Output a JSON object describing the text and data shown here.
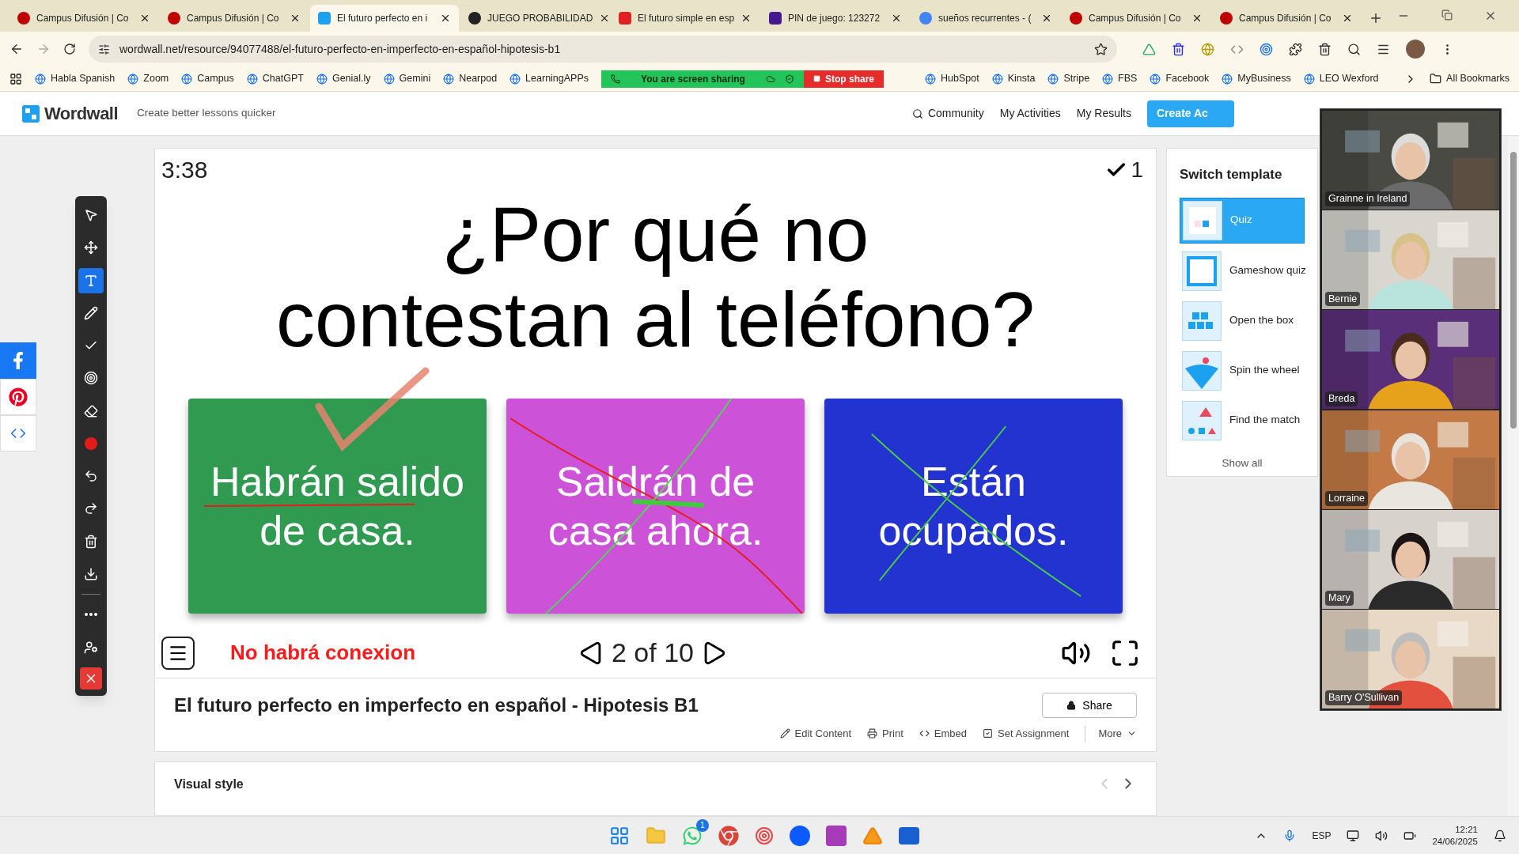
{
  "browser": {
    "tabs": [
      {
        "title": "Campus Difusión | Co",
        "kind": "campus",
        "selected": false
      },
      {
        "title": "Campus Difusión | Co",
        "kind": "campus",
        "selected": false
      },
      {
        "title": "El futuro perfecto en i",
        "kind": "wordwall",
        "selected": true
      },
      {
        "title": "JUEGO PROBABILIDAD",
        "kind": "genially",
        "selected": false
      },
      {
        "title": "El futuro simple en esp",
        "kind": "red",
        "selected": false
      },
      {
        "title": "PIN de juego: 123272",
        "kind": "kahoot",
        "selected": false
      },
      {
        "title": "sueños recurrentes - (",
        "kind": "google",
        "selected": false
      },
      {
        "title": "Campus Difusión | Co",
        "kind": "campus",
        "selected": false
      },
      {
        "title": "Campus Difusión | Co",
        "kind": "campus",
        "selected": false
      }
    ],
    "url": "wordwall.net/resource/94077488/el-futuro-perfecto-en-imperfecto-en-español-hipotesis-b1",
    "bookmarks_left": [
      "Habla Spanish",
      "Zoom",
      "Campus",
      "ChatGPT",
      "Genial.ly",
      "Gemini",
      "Nearpod",
      "LearningAPPs"
    ],
    "bookmarks_right": [
      "HubSpot",
      "Kinsta",
      "Stripe",
      "FBS",
      "Facebook",
      "MyBusiness",
      "LEO Wexford"
    ],
    "all_bookmarks": "All Bookmarks"
  },
  "screen_share": {
    "status": "You are screen sharing",
    "stop": "Stop share"
  },
  "header": {
    "logo": "Wordwall",
    "tagline": "Create better lessons quicker",
    "nav": [
      "Community",
      "My Activities",
      "My Results"
    ],
    "create": "Create Ac"
  },
  "tools": [
    {
      "kind": "pointer",
      "selected": false
    },
    {
      "kind": "move",
      "selected": false
    },
    {
      "kind": "text",
      "selected": true
    },
    {
      "kind": "pen",
      "selected": false
    },
    {
      "kind": "check",
      "selected": false
    },
    {
      "kind": "spotlight",
      "selected": false
    },
    {
      "kind": "eraser",
      "selected": false
    },
    {
      "kind": "record",
      "selected": false
    },
    {
      "kind": "undo",
      "selected": false
    },
    {
      "kind": "redo",
      "selected": false
    },
    {
      "kind": "trash",
      "selected": false
    },
    {
      "kind": "download",
      "selected": false
    },
    {
      "kind": "more",
      "selected": false
    },
    {
      "kind": "user",
      "selected": false
    },
    {
      "kind": "close",
      "selected": false
    }
  ],
  "game": {
    "timer": "3:38",
    "score": "1",
    "question": [
      "¿Por qué no",
      "contestan al teléfono?"
    ],
    "answers": [
      {
        "text": [
          "Habrán salido",
          "de casa."
        ],
        "color": "#2f9a50",
        "kind": "tick"
      },
      {
        "text": [
          "Saldrán de",
          "casa ahora."
        ],
        "color": "#cc52d8",
        "kind": "scribble"
      },
      {
        "text": [
          "Están",
          "ocupados."
        ],
        "color": "#2333cf",
        "kind": "cross"
      }
    ],
    "note": "No habrá conexion",
    "progress": "2 of 10"
  },
  "activity": {
    "title": "El futuro perfecto en imperfecto en español - Hipotesis B1",
    "share": "Share",
    "actions": [
      {
        "kind": "edit",
        "label": "Edit Content"
      },
      {
        "kind": "print",
        "label": "Print"
      },
      {
        "kind": "embed",
        "label": "Embed"
      },
      {
        "kind": "assign",
        "label": "Set Assignment"
      },
      {
        "kind": "more",
        "label": "More"
      }
    ]
  },
  "visual_style": {
    "title": "Visual style"
  },
  "templates": {
    "title": "Switch template",
    "items": [
      {
        "kind": "quiz",
        "label": "Quiz",
        "selected": true
      },
      {
        "kind": "gameshow",
        "label": "Gameshow quiz",
        "selected": false
      },
      {
        "kind": "box",
        "label": "Open the box",
        "selected": false
      },
      {
        "kind": "wheel",
        "label": "Spin the wheel",
        "selected": false
      },
      {
        "kind": "match",
        "label": "Find the match",
        "selected": false
      }
    ],
    "show_all": "Show all"
  },
  "participants": [
    {
      "name": "Grainne in Ireland",
      "kind": "picture"
    },
    {
      "name": "Bernie",
      "kind": "picture"
    },
    {
      "name": "Breda",
      "kind": "picture"
    },
    {
      "name": "Lorraine",
      "kind": "picture"
    },
    {
      "name": "Mary",
      "kind": "picture"
    },
    {
      "name": "Barry O'Sullivan",
      "kind": "picture"
    }
  ],
  "taskbar": {
    "badge": "1",
    "language": "ESP",
    "time": "12:21",
    "date": "24/06/2025"
  }
}
